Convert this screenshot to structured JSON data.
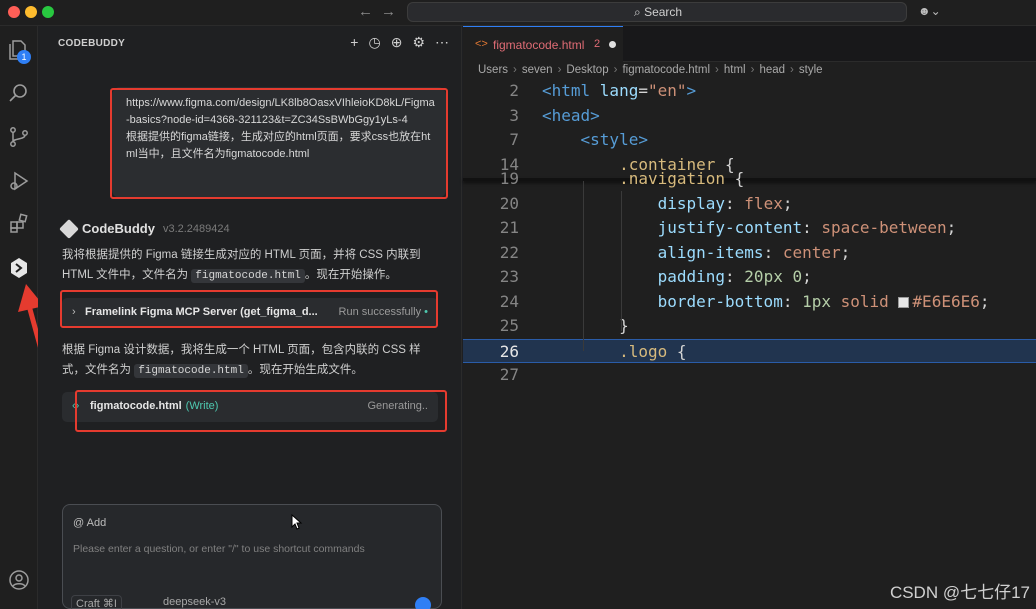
{
  "titlebar": {
    "search_label": "Search"
  },
  "activity": {
    "explorer_badge": "1"
  },
  "panel": {
    "title": "CODEBUDDY",
    "user_message": {
      "url_text": "https://www.figma.com/design/LK8lb8OasxVIhleioKD8kL/Figma-basics?node-id=4368-321123&t=ZC34SsBWbGgy1yLs-4",
      "request_text": "根据提供的figma链接，生成对应的html页面，要求css也放在html当中，且文件名为figmatocode.html"
    },
    "bot": {
      "name": "CodeBuddy",
      "version": "v3.2.2489424"
    },
    "para1": {
      "before": "我将根据提供的 Figma 链接生成对应的 HTML 页面，并将 CSS 内联到 HTML 文件中，文件名为 ",
      "code": "figmatocode.html",
      "after": "。现在开始操作。"
    },
    "tool_call": {
      "name": "Framelink Figma MCP Server (get_figma_d...",
      "status": "Run successfully"
    },
    "para2": {
      "before": "根据 Figma 设计数据，我将生成一个 HTML 页面，包含内联的 CSS 样式，文件名为 ",
      "code": "figmatocode.html",
      "after": "。现在开始生成文件。"
    },
    "file_write": {
      "filename": "figmatocode.html",
      "mode": "(Write)",
      "status": "Generating.."
    },
    "input": {
      "add_label": "@ Add",
      "placeholder": "Please enter a question, or enter \"/\" to use shortcut commands",
      "mode_label": "Craft ⌘I",
      "model_label": "deepseek-v3"
    }
  },
  "editor": {
    "tab": {
      "filename": "figmatocode.html",
      "problems": "2"
    },
    "breadcrumb": [
      "Users",
      "seven",
      "Desktop",
      "figmatocode.html",
      "html",
      "head",
      "style"
    ],
    "sticky_lines": [
      {
        "no": "2",
        "tokens": [
          [
            "tag",
            "<html "
          ],
          [
            "attr",
            "lang"
          ],
          [
            "punct",
            "="
          ],
          [
            "str",
            "\"en\""
          ],
          [
            "tag",
            ">"
          ]
        ]
      },
      {
        "no": "3",
        "tokens": [
          [
            "tag",
            "<head>"
          ]
        ]
      },
      {
        "no": "7",
        "tokens": [
          [
            "punct",
            "    "
          ],
          [
            "tag",
            "<style>"
          ]
        ]
      },
      {
        "no": "14",
        "tokens": [
          [
            "punct",
            "        "
          ],
          [
            "sel",
            ".container"
          ],
          [
            "brace",
            " {"
          ]
        ]
      }
    ],
    "lines": [
      {
        "no": "19",
        "tokens": [
          [
            "punct",
            "        "
          ],
          [
            "sel",
            ".navigation"
          ],
          [
            "brace",
            " {"
          ]
        ]
      },
      {
        "no": "20",
        "tokens": [
          [
            "punct",
            "            "
          ],
          [
            "prop",
            "display"
          ],
          [
            "punct",
            ": "
          ],
          [
            "val",
            "flex"
          ],
          [
            "punct",
            ";"
          ]
        ]
      },
      {
        "no": "21",
        "tokens": [
          [
            "punct",
            "            "
          ],
          [
            "prop",
            "justify-content"
          ],
          [
            "punct",
            ": "
          ],
          [
            "val",
            "space-between"
          ],
          [
            "punct",
            ";"
          ]
        ]
      },
      {
        "no": "22",
        "tokens": [
          [
            "punct",
            "            "
          ],
          [
            "prop",
            "align-items"
          ],
          [
            "punct",
            ": "
          ],
          [
            "val",
            "center"
          ],
          [
            "punct",
            ";"
          ]
        ]
      },
      {
        "no": "23",
        "tokens": [
          [
            "punct",
            "            "
          ],
          [
            "prop",
            "padding"
          ],
          [
            "punct",
            ": "
          ],
          [
            "num",
            "20px 0"
          ],
          [
            "punct",
            ";"
          ]
        ]
      },
      {
        "no": "24",
        "tokens": [
          [
            "punct",
            "            "
          ],
          [
            "prop",
            "border-bottom"
          ],
          [
            "punct",
            ": "
          ],
          [
            "num",
            "1px "
          ],
          [
            "val",
            "solid "
          ],
          [
            "swatch",
            ""
          ],
          [
            "val",
            "#E6E6E6"
          ],
          [
            "punct",
            ";"
          ]
        ]
      },
      {
        "no": "25",
        "tokens": [
          [
            "punct",
            "        "
          ],
          [
            "brace",
            "}"
          ]
        ]
      },
      {
        "no": "26",
        "tokens": [
          [
            "punct",
            "        "
          ],
          [
            "sel",
            ".logo"
          ],
          [
            "brace",
            " {"
          ]
        ]
      },
      {
        "no": "27",
        "tokens": [
          [
            "punct",
            ""
          ]
        ]
      }
    ]
  },
  "watermark": "CSDN @七七仔17"
}
